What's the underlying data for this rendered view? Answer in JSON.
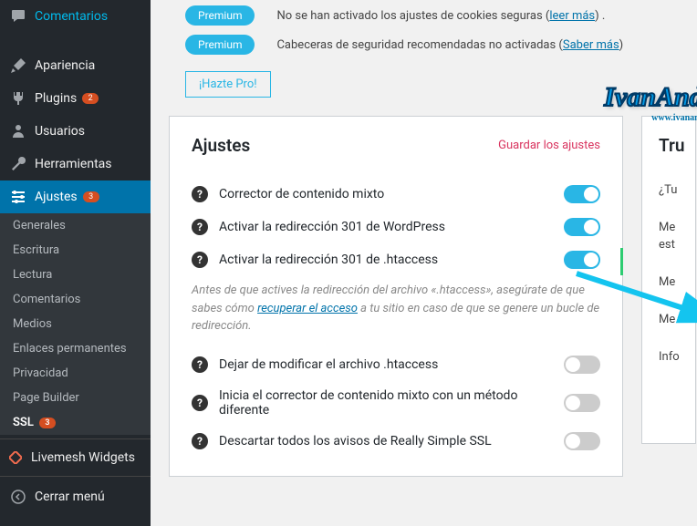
{
  "sidebar": {
    "items": [
      {
        "label": "Comentarios",
        "icon": "comment"
      },
      {
        "label": "Apariencia",
        "icon": "brush"
      },
      {
        "label": "Plugins",
        "icon": "plug",
        "badge": "2"
      },
      {
        "label": "Usuarios",
        "icon": "user"
      },
      {
        "label": "Herramientas",
        "icon": "wrench"
      },
      {
        "label": "Ajustes",
        "icon": "sliders",
        "badge": "3",
        "active": true
      }
    ],
    "submenu": [
      "Generales",
      "Escritura",
      "Lectura",
      "Comentarios",
      "Medios",
      "Enlaces permanentes",
      "Privacidad",
      "Page Builder"
    ],
    "ssl": {
      "label": "SSL",
      "badge": "3"
    },
    "livemesh": "Livemesh Widgets",
    "collapse": "Cerrar menú"
  },
  "top": {
    "rows": [
      {
        "pill": "Premium",
        "text": "No se han activado los ajustes de cookies seguras (",
        "link": "leer más",
        "tail": ") ."
      },
      {
        "pill": "Premium",
        "text": "Cabeceras de seguridad recomendadas no activadas (",
        "link": "Saber más",
        "tail": ")"
      }
    ],
    "pro_btn": "¡Hazte Pro!"
  },
  "settings": {
    "title": "Ajustes",
    "save": "Guardar los ajustes",
    "rows": [
      {
        "label": "Corrector de contenido mixto",
        "on": true
      },
      {
        "label": "Activar la redirección 301 de WordPress",
        "on": true
      },
      {
        "label": "Activar la redirección 301 de .htaccess",
        "on": true,
        "highlight": true
      }
    ],
    "hint_pre": "Antes de que actives la redirección del archivo «.htaccess», asegúrate de que sabes cómo ",
    "hint_link": "recuperar el acceso",
    "hint_post": " a tu sitio en caso de que se genere un bucle de redirección.",
    "rows2": [
      {
        "label": "Dejar de modificar el archivo .htaccess",
        "on": false
      },
      {
        "label": "Inicia el corrector de contenido mixto con un método diferente",
        "on": false
      },
      {
        "label": "Descartar todos los avisos de Really Simple SSL",
        "on": false
      }
    ]
  },
  "right": {
    "title": "Tru",
    "lines": [
      "¿Tu",
      "Me",
      "est",
      "Me",
      "Me",
      "Info"
    ]
  },
  "watermark": {
    "main": "IvanAndrei",
    "sub": "www.ivanandrei.com"
  }
}
